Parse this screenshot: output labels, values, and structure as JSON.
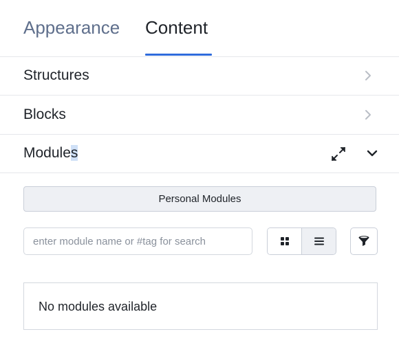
{
  "tabs": [
    {
      "label": "Appearance",
      "active": false
    },
    {
      "label": "Content",
      "active": true
    }
  ],
  "accent_color": "#2f6bdc",
  "sections": {
    "structures": {
      "label": "Structures",
      "icon": "chevron-right-icon"
    },
    "blocks": {
      "label": "Blocks",
      "icon": "chevron-right-icon"
    },
    "modules": {
      "label_main": "Module",
      "label_selected": "s",
      "expand_icon": "expand-arrows-icon",
      "collapse_icon": "chevron-down-icon"
    }
  },
  "modules_panel": {
    "personal_button_label": "Personal Modules",
    "search_placeholder": "enter module name or #tag for search",
    "search_value": "",
    "view_modes": [
      {
        "name": "grid",
        "icon": "grid-icon",
        "active": false
      },
      {
        "name": "list",
        "icon": "list-icon",
        "active": true
      }
    ],
    "filter_icon": "filter-icon",
    "empty_message": "No modules available"
  }
}
